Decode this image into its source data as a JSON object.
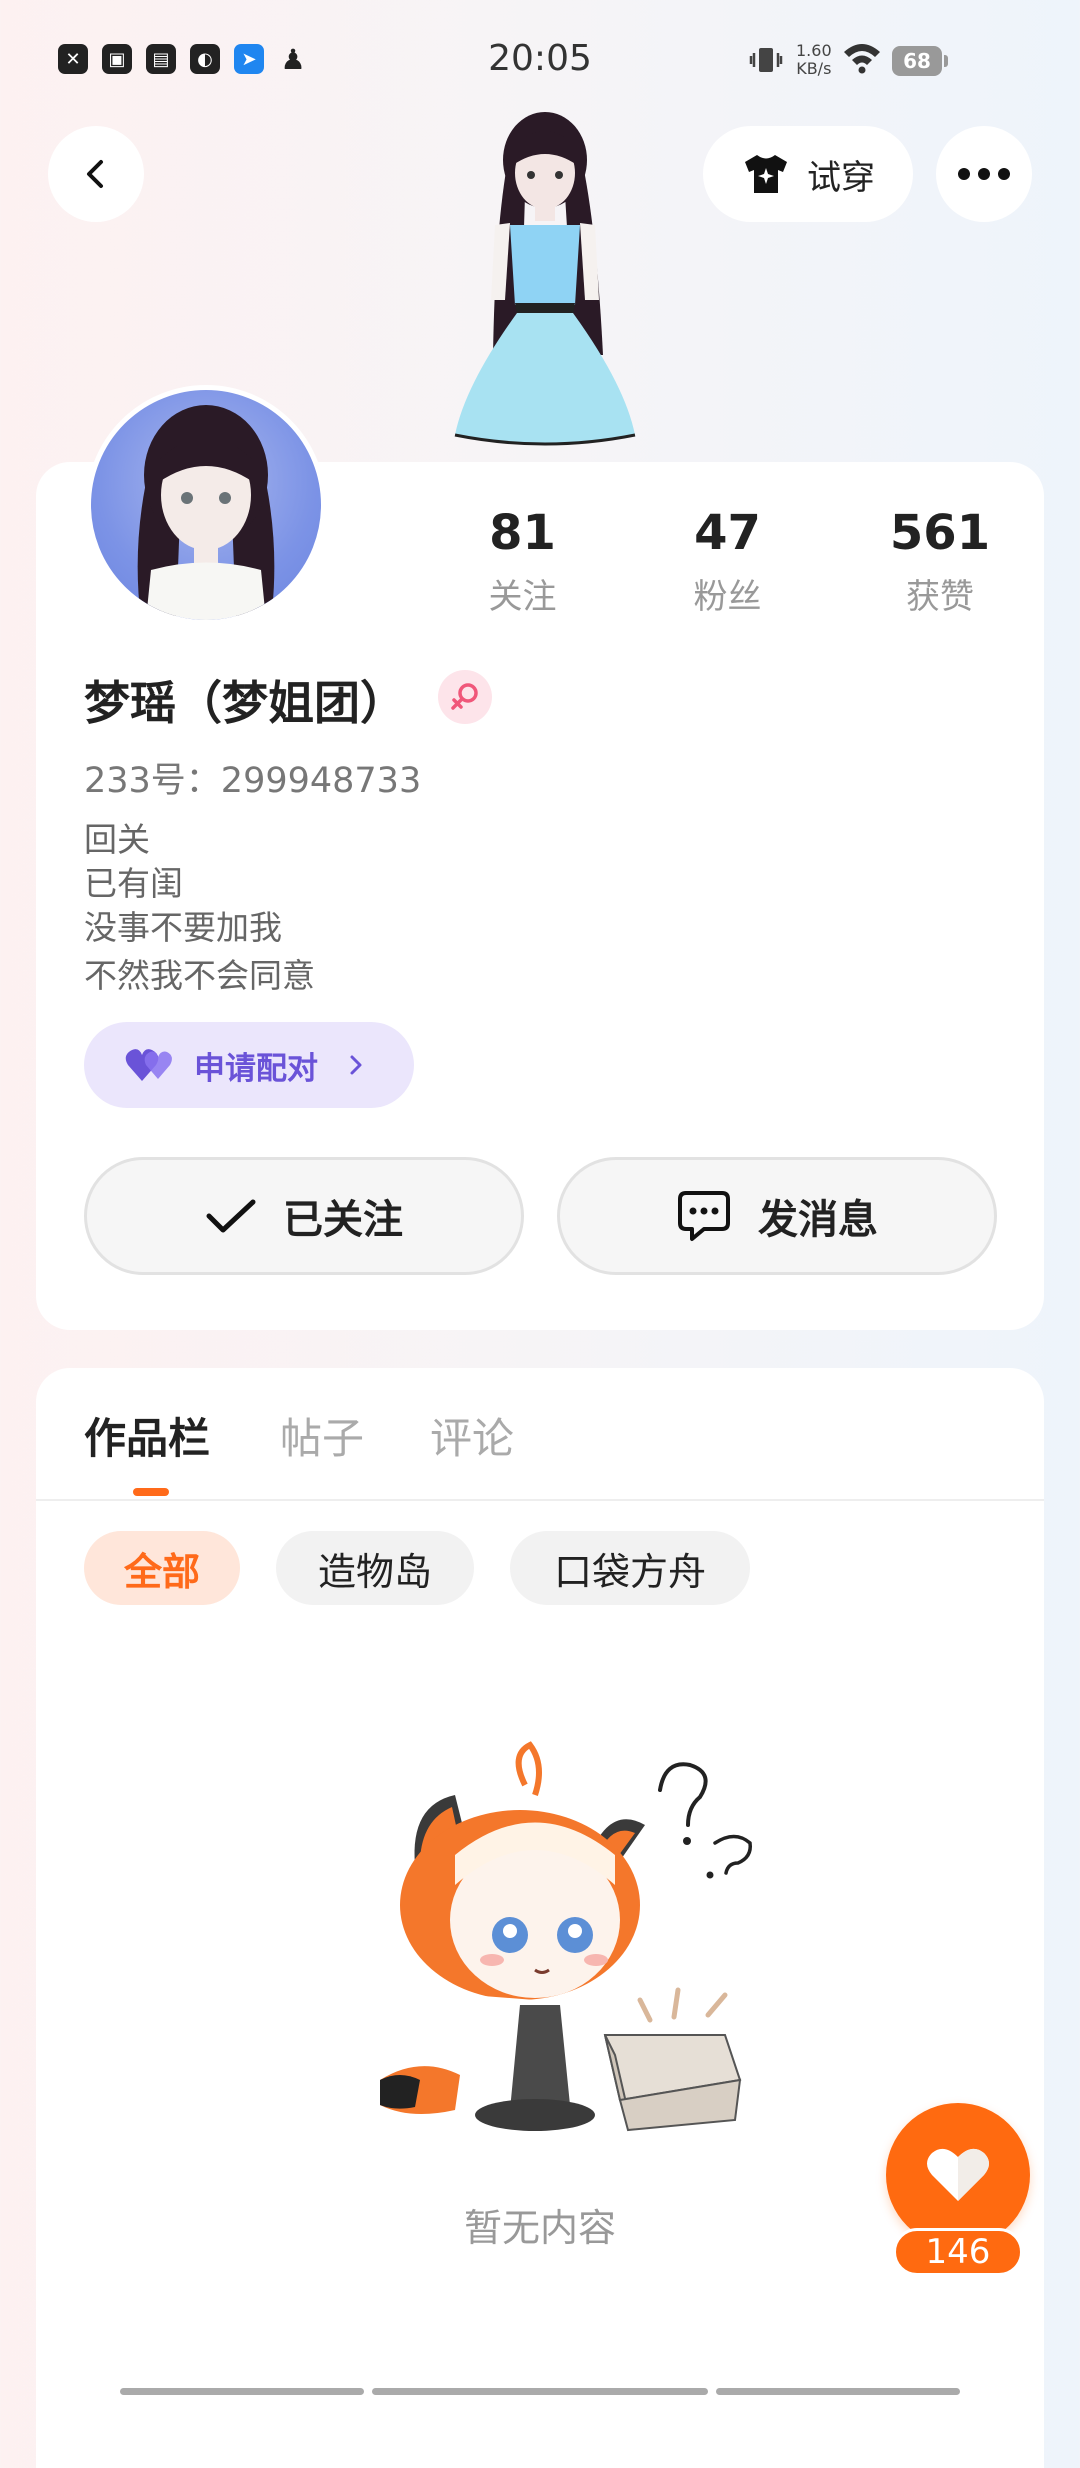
{
  "status_bar": {
    "time": "20:05",
    "net_speed_value": "1.60",
    "net_speed_unit": "KB/s",
    "battery": "68",
    "left_icons": [
      "close-notify-icon",
      "gallery-icon",
      "card-icon",
      "game-icon",
      "feishu-icon",
      "qq-icon"
    ]
  },
  "header": {
    "try_on_label": "试穿"
  },
  "profile": {
    "stats": [
      {
        "value": "81",
        "label": "关注"
      },
      {
        "value": "47",
        "label": "粉丝"
      },
      {
        "value": "561",
        "label": "获赞"
      }
    ],
    "username": "梦瑶（梦姐团）",
    "gender": "female",
    "id_text": "233号：299948733",
    "bio_lines": [
      "回关",
      "已有闺",
      "没事不要加我",
      "不然我不会同意"
    ],
    "pair_label": "申请配对",
    "follow_label": "已关注",
    "message_label": "发消息"
  },
  "tabs": {
    "items": [
      {
        "label": "作品栏",
        "active": true
      },
      {
        "label": "帖子",
        "active": false
      },
      {
        "label": "评论",
        "active": false
      }
    ]
  },
  "filters": {
    "items": [
      {
        "label": "全部",
        "active": true
      },
      {
        "label": "造物岛",
        "active": false
      },
      {
        "label": "口袋方舟",
        "active": false
      }
    ]
  },
  "empty_state": {
    "text": "暂无内容"
  },
  "like": {
    "count": "146"
  },
  "colors": {
    "accent": "#ff6a10",
    "pair_purple": "#6a53d8",
    "gender_pink": "#f0577a"
  }
}
